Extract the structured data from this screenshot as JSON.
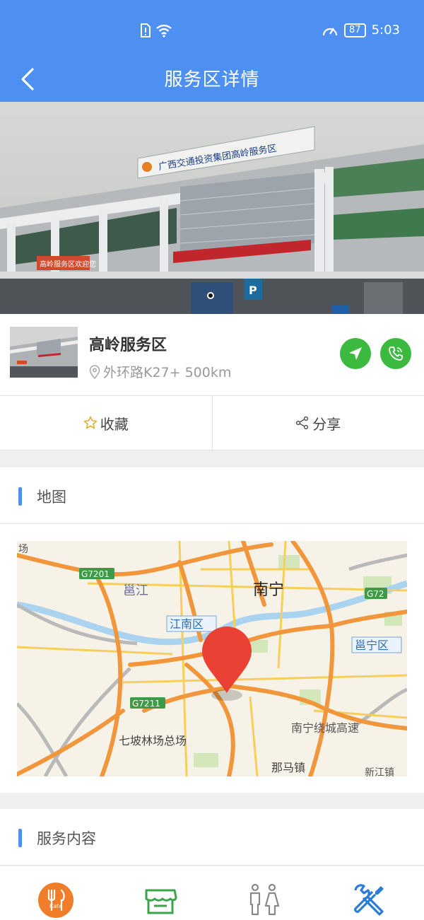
{
  "status": {
    "time": "5:03",
    "battery": "87"
  },
  "nav": {
    "title": "服务区详情"
  },
  "hero": {
    "sign_text": "广西交通投资集团高岭服务区",
    "banner_text": "高岭服务区欢迎您",
    "parking_label": "P"
  },
  "service_area": {
    "name": "高岭服务区",
    "location": "外环路K27+ 500km"
  },
  "actions": {
    "favorite_label": "收藏",
    "share_label": "分享"
  },
  "sections": {
    "map_title": "地图",
    "services_title": "服务内容"
  },
  "map": {
    "labels": {
      "nanning": "南宁",
      "jiangnan": "江南区",
      "yongjiang": "邕江",
      "yongning": "邕宁区",
      "qipo": "七坡林场总场",
      "nama": "那马镇",
      "xinjiang": "新江镇",
      "ring": "南宁绕城高速",
      "g7201": "G7201",
      "g7211": "G7211",
      "g72": "G72",
      "chang": "场"
    }
  },
  "tabs": [
    {
      "name": "food",
      "label": "Cate"
    },
    {
      "name": "shop"
    },
    {
      "name": "restroom"
    },
    {
      "name": "repair"
    }
  ],
  "colors": {
    "primary": "#4d90f2",
    "green": "#3cb93f",
    "marker": "#e94235"
  }
}
